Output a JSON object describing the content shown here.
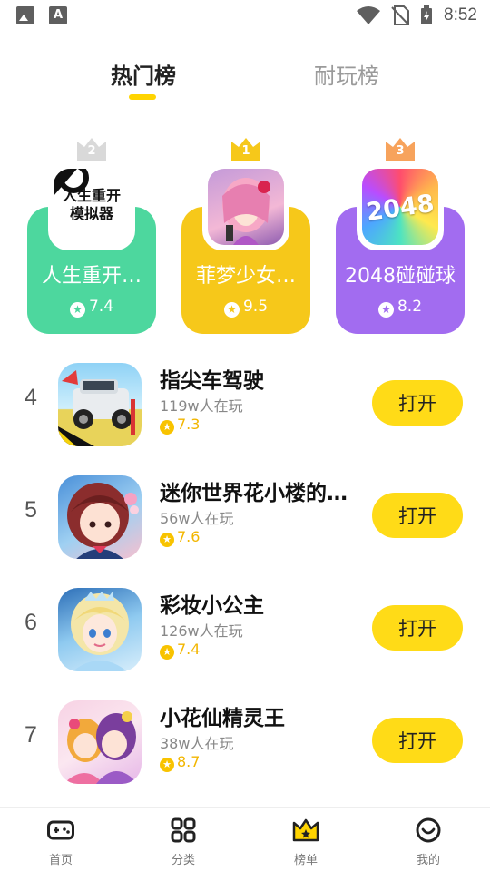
{
  "status_bar": {
    "time": "8:52"
  },
  "tabs": [
    {
      "label": "热门榜",
      "active": true
    },
    {
      "label": "耐玩榜",
      "active": false
    }
  ],
  "top3": [
    {
      "rank": "2",
      "name": "人生重开…",
      "score": "7.4",
      "icon_text": [
        "人生重开",
        "模拟器"
      ],
      "color": "#4DD79E",
      "crown_color": "#D9D9D9"
    },
    {
      "rank": "1",
      "name": "菲梦少女…",
      "score": "9.5",
      "color": "#F6C81A",
      "crown_color": "#F6C81A"
    },
    {
      "rank": "3",
      "name": "2048碰碰球",
      "score": "8.2",
      "icon_text": [
        "2048"
      ],
      "color": "#A26CF0",
      "crown_color": "#F7A35C"
    }
  ],
  "list": [
    {
      "rank": "4",
      "name": "指尖车驾驶",
      "players": "119w人在玩",
      "score": "7.3",
      "button": "打开"
    },
    {
      "rank": "5",
      "name": "迷你世界花小楼的…",
      "players": "56w人在玩",
      "score": "7.6",
      "button": "打开"
    },
    {
      "rank": "6",
      "name": "彩妆小公主",
      "players": "126w人在玩",
      "score": "7.4",
      "button": "打开"
    },
    {
      "rank": "7",
      "name": "小花仙精灵王",
      "players": "38w人在玩",
      "score": "8.7",
      "button": "打开"
    }
  ],
  "bottom_nav": [
    {
      "label": "首页",
      "icon": "gamepad-icon"
    },
    {
      "label": "分类",
      "icon": "grid-icon"
    },
    {
      "label": "榜单",
      "icon": "crown-icon"
    },
    {
      "label": "我的",
      "icon": "smile-icon"
    }
  ]
}
